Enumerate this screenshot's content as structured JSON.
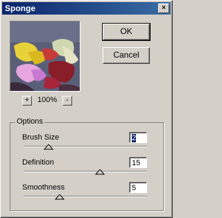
{
  "window": {
    "title": "Sponge"
  },
  "icons": {
    "close": "close-icon"
  },
  "buttons": {
    "ok": "OK",
    "cancel": "Cancel"
  },
  "preview": {
    "zoom_in": "+",
    "zoom_out": "-",
    "zoom_level": "100%"
  },
  "options": {
    "title": "Options",
    "params": [
      {
        "label": "Brush Size",
        "value": "2",
        "fraction": 0.2
      },
      {
        "label": "Definition",
        "value": "15",
        "fraction": 0.6
      },
      {
        "label": "Smoothness",
        "value": "5",
        "fraction": 0.4
      }
    ]
  }
}
